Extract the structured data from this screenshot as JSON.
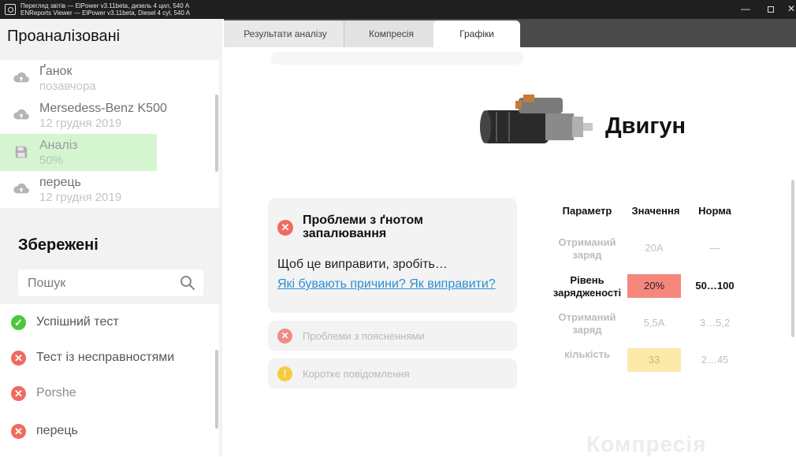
{
  "window": {
    "title_line1": "Перегляд звітів — ElPower v3.11beta, дизель 4 цил, 540 A",
    "title_line2": "ENReports Viewer — ElPower v3.11beta, Diesel 4 cyl, 540 A",
    "minimize_label": "—",
    "close_label": "✕"
  },
  "sidebar": {
    "analyzed_title": "Проаналізовані",
    "analyzed_items": [
      {
        "name": "Ґанок",
        "sub": "позавчора",
        "icon": "cloud-upload-icon"
      },
      {
        "name": "Mersedess-Benz K500",
        "sub": "12 грудня 2019",
        "icon": "cloud-upload-icon"
      },
      {
        "name": "Аналіз",
        "sub": "50%",
        "icon": "save-icon"
      },
      {
        "name": "перець",
        "sub": "12 грудня 2019",
        "icon": "cloud-upload-icon"
      }
    ],
    "saved_title": "Збережені",
    "search_placeholder": "Пошук",
    "saved_items": [
      {
        "name": "Успішний тест",
        "status": "ok"
      },
      {
        "name": "Тест із несправностями",
        "status": "bad"
      },
      {
        "name": "Porshe",
        "status": "bad"
      },
      {
        "name": "перець",
        "status": "bad"
      }
    ]
  },
  "tabs": [
    {
      "label": "Результати аналізу"
    },
    {
      "label": "Компресія"
    },
    {
      "label": "Графіки"
    }
  ],
  "main": {
    "engine_title": "Двигун",
    "issue_card": {
      "title": "Проблеми з ґнотом запалювання",
      "description": "Щоб це виправити, зробіть…",
      "link": "Які бувають причини? Як виправити?"
    },
    "mini_cards": [
      {
        "text": "Проблеми з поясненнями",
        "status": "error"
      },
      {
        "text": "Коротке повідомлення",
        "status": "warning"
      }
    ],
    "table": {
      "headers": {
        "param": "Параметр",
        "value": "Значення",
        "norm": "Норма"
      },
      "rows": [
        {
          "param": "Отриманий заряд",
          "value": "20A",
          "norm": "—"
        },
        {
          "param": "Рівень зарядженості",
          "value": "20%",
          "norm": "50…100"
        },
        {
          "param": "Отриманий заряд",
          "value": "5,5A",
          "norm": "3…5,2"
        },
        {
          "param": "кількість",
          "value": "33",
          "norm": "2…45"
        }
      ]
    },
    "bottom_faded_title": "Компресія"
  },
  "colors": {
    "ok": "#4cc83c",
    "error": "#f06a60",
    "warning": "#f5c000",
    "active_item": "#d4f5d0",
    "link": "#2a8fd6",
    "value_bad": "#f5877d",
    "value_warn": "#fde9a8"
  }
}
